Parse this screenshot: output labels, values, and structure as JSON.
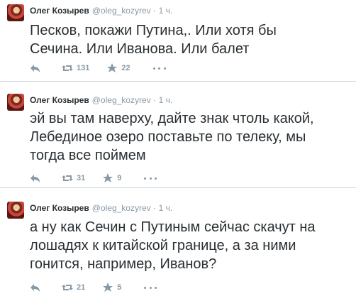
{
  "tweets": [
    {
      "author_name": "Олег Козырев",
      "handle": "@oleg_kozyrev",
      "separator": "·",
      "time": "1 ч.",
      "text": "Песков, покажи Путина,. Или хотя бы\nСечина. Или Иванова. Или балет",
      "retweet_count": "131",
      "favorite_count": "22"
    },
    {
      "author_name": "Олег Козырев",
      "handle": "@oleg_kozyrev",
      "separator": "·",
      "time": "1 ч.",
      "text": "эй вы там наверху, дайте знак чтоль какой,\nЛебединое озеро поставьте по телеку, мы\nтогда все поймем",
      "retweet_count": "31",
      "favorite_count": "9"
    },
    {
      "author_name": "Олег Козырев",
      "handle": "@oleg_kozyrev",
      "separator": "·",
      "time": "1 ч.",
      "text": "а ну как Сечин с Путиным сейчас скачут на\nлошадях к китайской границе, а за ними\nгонится, например, Иванов?",
      "retweet_count": "21",
      "favorite_count": "5"
    }
  ],
  "icons": {
    "reply": "reply-icon",
    "retweet": "retweet-icon",
    "favorite": "star-icon",
    "more": "more-dots-icon"
  },
  "colors": {
    "text": "#292f33",
    "meta": "#8899a6",
    "divider": "#cfd6db"
  }
}
